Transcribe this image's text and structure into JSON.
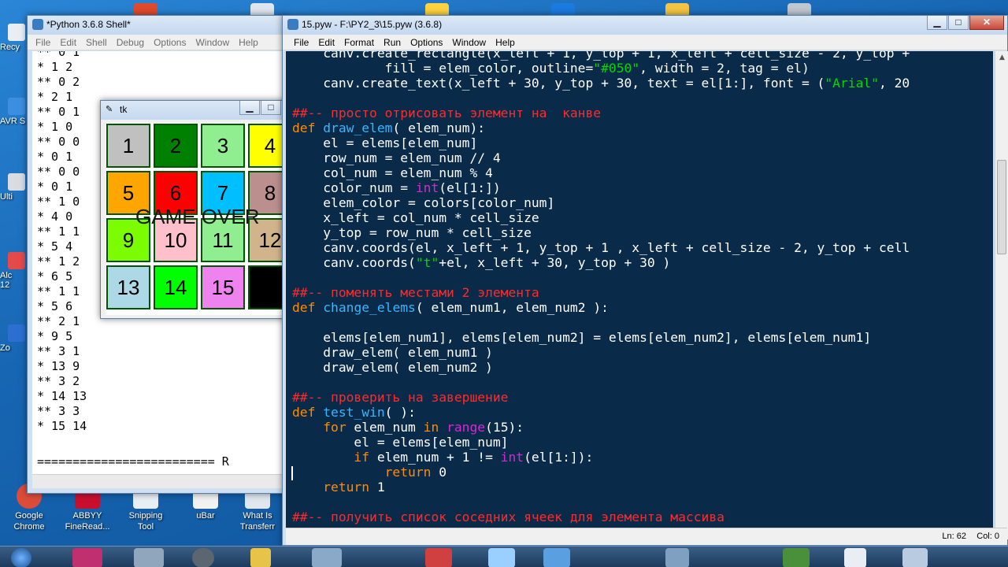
{
  "desktop": {
    "left_icons": [
      "Recy",
      "AVR S",
      "Ulti",
      "Alc\n12",
      "Zo"
    ],
    "bottom_icons": [
      "Google\nChrome",
      "ABBYY\nFineRead...",
      "Snipping\nTool",
      "uBar",
      "What Is\nTransferr"
    ]
  },
  "shell": {
    "title": "*Python 3.6.8 Shell*",
    "menu": [
      "File",
      "Edit",
      "Shell",
      "Debug",
      "Options",
      "Window",
      "Help"
    ],
    "lines": [
      "** 0 1",
      "* 1 2",
      "** 0 2",
      "* 2 1",
      "** 0 1",
      "* 1 0",
      "** 0 0",
      "* 0 1",
      "** 0 0",
      "* 0 1",
      "** 1 0",
      "* 4 0",
      "** 1 1",
      "* 5 4",
      "** 1 2",
      "* 6 5",
      "** 1 1",
      "* 5 6",
      "** 2 1",
      "* 9 5",
      "** 3 1",
      "* 13 9",
      "** 3 2",
      "* 14 13",
      "** 3 3",
      "* 15 14"
    ],
    "separator": "========================= R"
  },
  "tk": {
    "title": "tk",
    "cells": [
      {
        "label": "1",
        "color": "#c0c0c0"
      },
      {
        "label": "2",
        "color": "#008000"
      },
      {
        "label": "3",
        "color": "#90ee90"
      },
      {
        "label": "4",
        "color": "#ffff00"
      },
      {
        "label": "5",
        "color": "#ffa500"
      },
      {
        "label": "6",
        "color": "#ff0000"
      },
      {
        "label": "7",
        "color": "#00bfff"
      },
      {
        "label": "8",
        "color": "#bc8f8f"
      },
      {
        "label": "9",
        "color": "#7cfc00"
      },
      {
        "label": "10",
        "color": "#ffc0cb"
      },
      {
        "label": "11",
        "color": "#90ee90"
      },
      {
        "label": "12",
        "color": "#d2b48c"
      },
      {
        "label": "13",
        "color": "#add8e6"
      },
      {
        "label": "14",
        "color": "#00ff00"
      },
      {
        "label": "15",
        "color": "#ee82ee"
      },
      {
        "label": "",
        "color": "#000000"
      }
    ],
    "message": "GAME OVER"
  },
  "editor": {
    "title": "15.pyw - F:\\PY2_3\\15.pyw (3.6.8)",
    "menu": [
      "File",
      "Edit",
      "Format",
      "Run",
      "Options",
      "Window",
      "Help"
    ],
    "code_lines": [
      [
        [
          "",
          "    canv.create_rectangle(x_left + 1, y_top + 1, x_left + cell_size - 2, y_top +"
        ]
      ],
      [
        [
          "",
          "            fill = elem_color, outline="
        ],
        [
          "st",
          "\"#050\""
        ],
        [
          "",
          ", width = 2, tag = el)"
        ]
      ],
      [
        [
          "",
          "    canv.create_text(x_left + 30, y_top + 30, text = el[1:], font = ("
        ],
        [
          "st",
          "\"Arial\""
        ],
        [
          "",
          ", 20"
        ]
      ],
      [
        [
          "",
          ""
        ]
      ],
      [
        [
          "cm",
          "##-- просто отрисовать элемент на  канве"
        ]
      ],
      [
        [
          "kw",
          "def"
        ],
        [
          "",
          " "
        ],
        [
          "fn",
          "draw_elem"
        ],
        [
          "",
          "( elem_num):"
        ]
      ],
      [
        [
          "",
          "    el = elems[elem_num]"
        ]
      ],
      [
        [
          "",
          "    row_num = elem_num // 4"
        ]
      ],
      [
        [
          "",
          "    col_num = elem_num % 4"
        ]
      ],
      [
        [
          "",
          "    color_num = "
        ],
        [
          "bi",
          "int"
        ],
        [
          "",
          "(el[1:])"
        ]
      ],
      [
        [
          "",
          "    elem_color = colors[color_num]"
        ]
      ],
      [
        [
          "",
          "    x_left = col_num * cell_size"
        ]
      ],
      [
        [
          "",
          "    y_top = row_num * cell_size"
        ]
      ],
      [
        [
          "",
          "    canv.coords(el, x_left + 1, y_top + 1 , x_left + cell_size - 2, y_top + cell"
        ]
      ],
      [
        [
          "",
          "    canv.coords("
        ],
        [
          "st",
          "\"t\""
        ],
        [
          "",
          "+el, x_left + 30, y_top + 30 )"
        ]
      ],
      [
        [
          "",
          ""
        ]
      ],
      [
        [
          "cm",
          "##-- поменять местами 2 элемента"
        ]
      ],
      [
        [
          "kw",
          "def"
        ],
        [
          "",
          " "
        ],
        [
          "fn",
          "change_elems"
        ],
        [
          "",
          "( elem_num1, elem_num2 ):"
        ]
      ],
      [
        [
          "",
          ""
        ]
      ],
      [
        [
          "",
          "    elems[elem_num1], elems[elem_num2] = elems[elem_num2], elems[elem_num1]"
        ]
      ],
      [
        [
          "",
          "    draw_elem( elem_num1 )"
        ]
      ],
      [
        [
          "",
          "    draw_elem( elem_num2 )"
        ]
      ],
      [
        [
          "",
          ""
        ]
      ],
      [
        [
          "cm",
          "##-- проверить на завершение"
        ]
      ],
      [
        [
          "kw",
          "def"
        ],
        [
          "",
          " "
        ],
        [
          "fn",
          "test_win"
        ],
        [
          "",
          "( ):"
        ]
      ],
      [
        [
          "kw",
          "    for"
        ],
        [
          "",
          " elem_num "
        ],
        [
          "kw",
          "in"
        ],
        [
          "",
          " "
        ],
        [
          "bi",
          "range"
        ],
        [
          "",
          "(15):"
        ]
      ],
      [
        [
          "",
          "        el = elems[elem_num]"
        ]
      ],
      [
        [
          "kw",
          "        if"
        ],
        [
          "",
          " elem_num + 1 != "
        ],
        [
          "bi",
          "int"
        ],
        [
          "",
          "(el[1:]):"
        ]
      ],
      [
        [
          "kw",
          "            return"
        ],
        [
          "",
          " 0"
        ]
      ],
      [
        [
          "kw",
          "    return"
        ],
        [
          "",
          " 1"
        ]
      ],
      [
        [
          "",
          ""
        ]
      ],
      [
        [
          "cm",
          "##-- получить список соседних ячеек для элемента массива"
        ]
      ]
    ],
    "status": {
      "line": "Ln: 62",
      "col": "Col: 0"
    }
  },
  "colors": {
    "code_bg": "#0a2a4a",
    "comment": "#ff2a2a",
    "keyword": "#ff8c00",
    "funcname": "#38b6ff",
    "builtin": "#d22ad2",
    "string": "#00d800"
  }
}
